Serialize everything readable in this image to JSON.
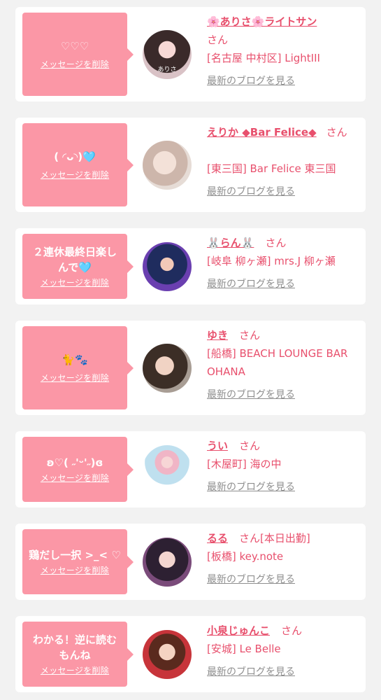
{
  "delete_label": "メッセージを削除",
  "blog_label": "最新のブログを見る",
  "san_label": "さん",
  "colors": {
    "page_bg": "#f2f2f2",
    "bubble": "#fb97a6",
    "accent_text": "#e8506d",
    "blog_link": "#8f8f8f"
  },
  "cards": [
    {
      "message": "♡♡♡",
      "name": "🌸ありさ🌸ライトサン",
      "extra": "",
      "shop": "[名古屋 中村区] LightIII",
      "avatar_caption": "ありさ"
    },
    {
      "message": "( ◜ᴗ◝)🩵",
      "name": "えりか ◆Bar Felice◆",
      "extra": "",
      "shop": "[東三国] Bar Felice 東三国",
      "avatar_caption": ""
    },
    {
      "message": "２連休最終日楽しんで🩵",
      "name": "🐰らん🐰",
      "extra": "",
      "shop": "[岐阜 柳ヶ瀬] mrs.J 柳ヶ瀬",
      "avatar_caption": ""
    },
    {
      "message": "🐈🐾",
      "name": "ゆき",
      "extra": "",
      "shop": "[船橋] BEACH LOUNGE BAR OHANA",
      "avatar_caption": ""
    },
    {
      "message": "ʚ♡( ˶'ᵕ'˶)ɞ",
      "name": "うい",
      "extra": "",
      "shop": "[木屋町] 海の中",
      "avatar_caption": ""
    },
    {
      "message": "鶏だし一択 >_< ♡",
      "name": "るる",
      "extra": "[本日出勤]",
      "shop": "[板橋] key.note",
      "avatar_caption": ""
    },
    {
      "message": "わかる！逆に読むもんね",
      "name": "小泉じゅんこ",
      "extra": "",
      "shop": "[安城] Le Belle",
      "avatar_caption": ""
    }
  ]
}
